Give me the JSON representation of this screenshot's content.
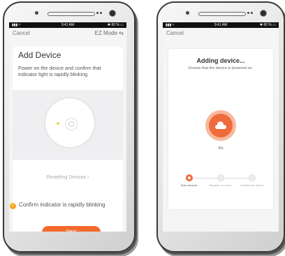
{
  "left_screen": {
    "status": {
      "signal": "▮▮▮ ≈",
      "time": "9:41 AM",
      "battery": "✱ 60 % ▭"
    },
    "nav": {
      "cancel": "Cancel",
      "mode": "EZ Mode ⇆"
    },
    "title": "Add Device",
    "instruction": "Power on the device and confirm that indicator light is rapidly blinking",
    "reset_link": "Resetting Devices ›",
    "confirm_text": "Confirm indicator is rapidly blinking",
    "check_icon": "✓",
    "next_label": "Next"
  },
  "right_screen": {
    "status": {
      "signal": "▮▮▮ ≈",
      "time": "9:41 AM",
      "battery": "✱ 60 % ▭"
    },
    "nav": {
      "cancel": "Cancel"
    },
    "title": "Adding device...",
    "subtitle": "Ensure that the device is powered on.",
    "progress": "5%",
    "progress_value": 5,
    "steps": [
      {
        "label": "Scan devices.",
        "state": "active"
      },
      {
        "label": "Register on Cloud.",
        "state": "inactive"
      },
      {
        "label": "Initialize the device.",
        "state": "inactive"
      }
    ]
  },
  "colors": {
    "accent": "#f26a2a",
    "ring": "#f6b99c",
    "check": "#f5a623"
  }
}
